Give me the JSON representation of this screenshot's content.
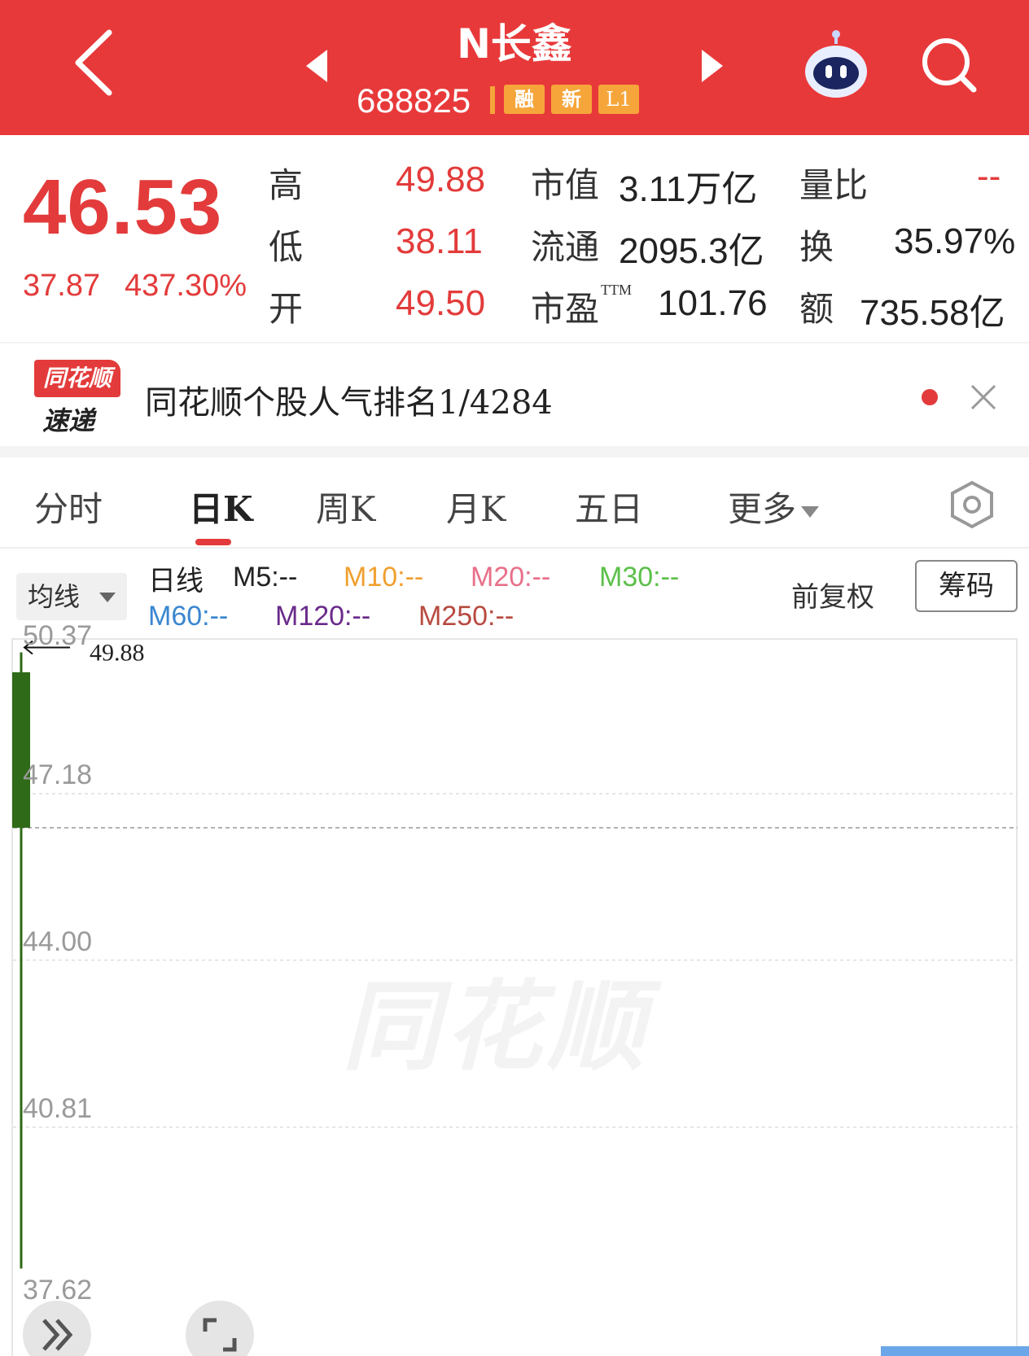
{
  "header": {
    "stock_name": "N长鑫",
    "stock_code": "688825",
    "tags": [
      "融",
      "新",
      "L1"
    ],
    "icons": [
      "back-arrow-icon",
      "prev-triangle-icon",
      "next-triangle-icon",
      "robot-assistant-icon",
      "search-icon"
    ]
  },
  "quote": {
    "price": "46.53",
    "change_amount": "37.87",
    "change_percent": "437.30%",
    "rows": [
      {
        "label": "高",
        "value": "49.88",
        "label2": "市值",
        "value2": "3.11万亿",
        "label3": "量比",
        "value3": "--"
      },
      {
        "label": "低",
        "value": "38.11",
        "label2": "流通",
        "value2": "2095.3亿",
        "label3": "换",
        "value3": "35.97%"
      },
      {
        "label": "开",
        "value": "49.50",
        "label2": "市盈",
        "label2_sup": "TTM",
        "value2": "101.76",
        "label3": "额",
        "value3": "735.58亿"
      }
    ]
  },
  "banner": {
    "logo_top": "同花顺",
    "logo_bottom": "速递",
    "text": "同花顺个股人气排名1/4284"
  },
  "tabs": {
    "items": [
      "分时",
      "日K",
      "周K",
      "月K",
      "五日",
      "更多"
    ],
    "active_index": 1
  },
  "indicators": {
    "select_label": "均线",
    "title": "日线",
    "ma": [
      {
        "label": "M5:--",
        "color": "#222222"
      },
      {
        "label": "M10:--",
        "color": "#f0a030"
      },
      {
        "label": "M20:--",
        "color": "#e8708a"
      },
      {
        "label": "M30:--",
        "color": "#5cc04a"
      },
      {
        "label": "M60:--",
        "color": "#3a86d0"
      },
      {
        "label": "M120:--",
        "color": "#6a2a8a"
      },
      {
        "label": "M250:--",
        "color": "#b84a40"
      }
    ],
    "adjust_label": "前复权",
    "chips_button": "筹码"
  },
  "chart_data": {
    "type": "candlestick",
    "y_ticks": [
      "50.37",
      "47.18",
      "44.00",
      "40.81",
      "37.62"
    ],
    "ylim": [
      37.62,
      50.37
    ],
    "max_label": "49.88",
    "candles": [
      {
        "open": 49.5,
        "high": 49.88,
        "low": 38.11,
        "close": 46.53,
        "color": "#2e6a17"
      }
    ],
    "reference_line": 46.53,
    "watermark": "同花顺"
  }
}
